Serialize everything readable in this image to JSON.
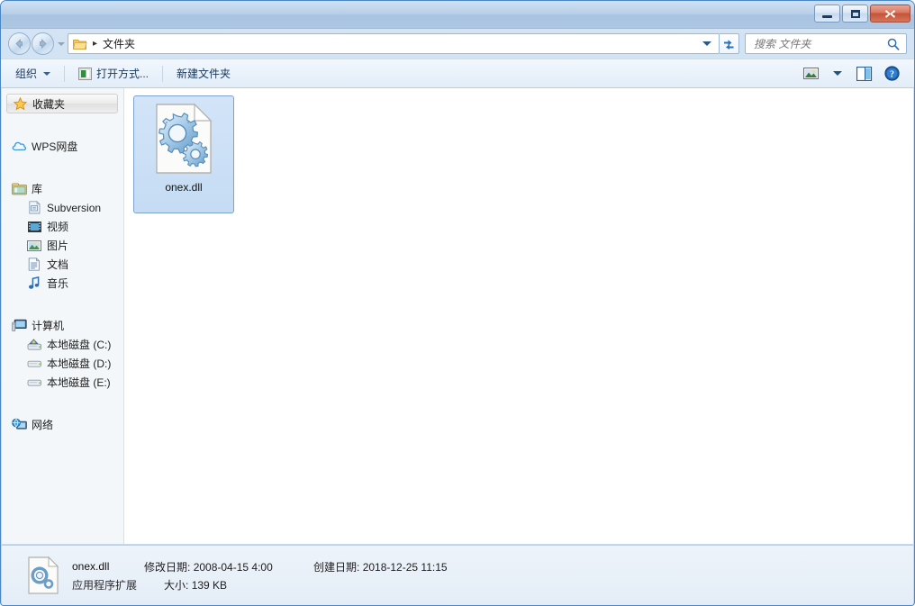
{
  "window": {
    "minimize_label": "最小化",
    "maximize_label": "最大化",
    "close_label": "关闭"
  },
  "address": {
    "back_label": "后退",
    "forward_label": "前进",
    "history_label": "最近浏览的位置",
    "folder_icon": "folder-icon",
    "separator": "▸",
    "crumb": "文件夹",
    "dropdown_label": "前往下拉列表",
    "refresh_label": "刷新"
  },
  "search": {
    "placeholder": "搜索 文件夹",
    "icon": "search-icon"
  },
  "toolbar": {
    "organize": "组织",
    "open_with": "打开方式...",
    "new_folder": "新建文件夹",
    "view_label": "更改您的视图",
    "preview_label": "显示预览窗格",
    "help_label": "帮助"
  },
  "sidebar": {
    "groups": [
      {
        "label": "收藏夹",
        "icon": "star-icon",
        "selected": true,
        "children": []
      },
      {
        "label": "WPS网盘",
        "icon": "cloud-icon",
        "selected": false,
        "children": []
      },
      {
        "label": "库",
        "icon": "library-icon",
        "selected": false,
        "children": [
          {
            "label": "Subversion",
            "icon": "subversion-icon"
          },
          {
            "label": "视频",
            "icon": "video-icon"
          },
          {
            "label": "图片",
            "icon": "pictures-icon"
          },
          {
            "label": "文档",
            "icon": "documents-icon"
          },
          {
            "label": "音乐",
            "icon": "music-icon"
          }
        ]
      },
      {
        "label": "计算机",
        "icon": "computer-icon",
        "selected": false,
        "children": [
          {
            "label": "本地磁盘 (C:)",
            "icon": "system-drive-icon"
          },
          {
            "label": "本地磁盘 (D:)",
            "icon": "drive-icon"
          },
          {
            "label": "本地磁盘 (E:)",
            "icon": "drive-icon"
          }
        ]
      },
      {
        "label": "网络",
        "icon": "network-icon",
        "selected": false,
        "children": []
      }
    ]
  },
  "files": [
    {
      "name": "onex.dll",
      "icon": "dll-icon",
      "selected": true
    }
  ],
  "status": {
    "file_name": "onex.dll",
    "modified_label": "修改日期:",
    "modified_value": "2008-04-15 4:00",
    "created_label": "创建日期:",
    "created_value": "2018-12-25 11:15",
    "file_type": "应用程序扩展",
    "size_label": "大小:",
    "size_value": "139 KB",
    "icon": "dll-icon-small"
  },
  "colors": {
    "titlebar_top": "#cfe0f2",
    "titlebar_bottom": "#adc7e3",
    "window_border": "#4a87c4",
    "selection_fill": "#cbdff6",
    "selection_border": "#7da2ce",
    "close_button": "#c25434",
    "content_bg": "#ffffff",
    "sidebar_bg": "#f4f7fa",
    "statusbar_bg": "#e8f0f8"
  }
}
